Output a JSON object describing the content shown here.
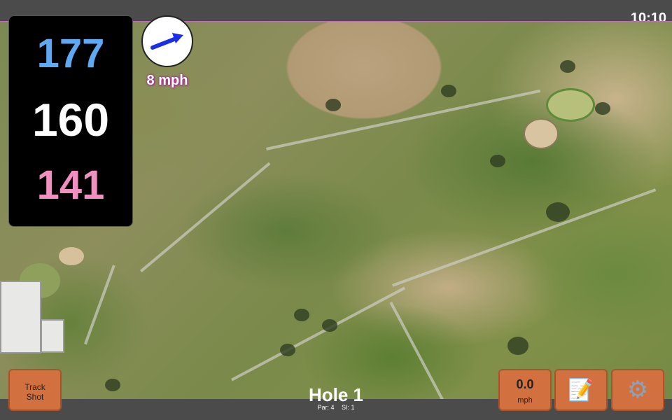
{
  "status": {
    "time": "10:10"
  },
  "yardage": {
    "back": "177",
    "middle": "160",
    "front": "141"
  },
  "wind": {
    "speed_label": "8 mph",
    "arrow_color": "#1a2ee8"
  },
  "hole": {
    "title": "Hole 1",
    "par": "Par: 4",
    "si": "SI: 1"
  },
  "buttons": {
    "track_shot_line1": "Track",
    "track_shot_line2": "Shot",
    "speed_value": "0.0",
    "speed_unit": "mph",
    "notes_icon": "notes-icon",
    "settings_icon": "gear-icon"
  },
  "colors": {
    "back_yardage": "#5fa8f2",
    "front_yardage": "#f090c0",
    "button_bg": "#d2713f",
    "accent_border": "#c06bc0"
  }
}
